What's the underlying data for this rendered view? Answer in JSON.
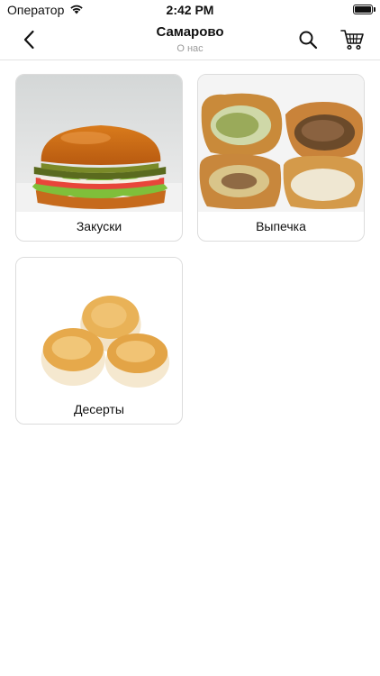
{
  "status_bar": {
    "carrier": "Оператор",
    "time": "2:42 PM",
    "wifi_icon": "wifi-icon",
    "battery_icon": "battery-icon",
    "battery_level": 1.0
  },
  "nav": {
    "title": "Самарово",
    "subtitle": "О нас",
    "back_icon": "chevron-left-icon",
    "search_icon": "search-icon",
    "cart_icon": "cart-icon"
  },
  "categories": [
    {
      "label": "Закуски",
      "image": "burger"
    },
    {
      "label": "Выпечка",
      "image": "pies"
    },
    {
      "label": "Десерты",
      "image": "syrniki"
    }
  ],
  "colors": {
    "divider": "#e3e3e3",
    "card_border": "#dcdcdc",
    "subtitle": "#9a9a9a"
  }
}
